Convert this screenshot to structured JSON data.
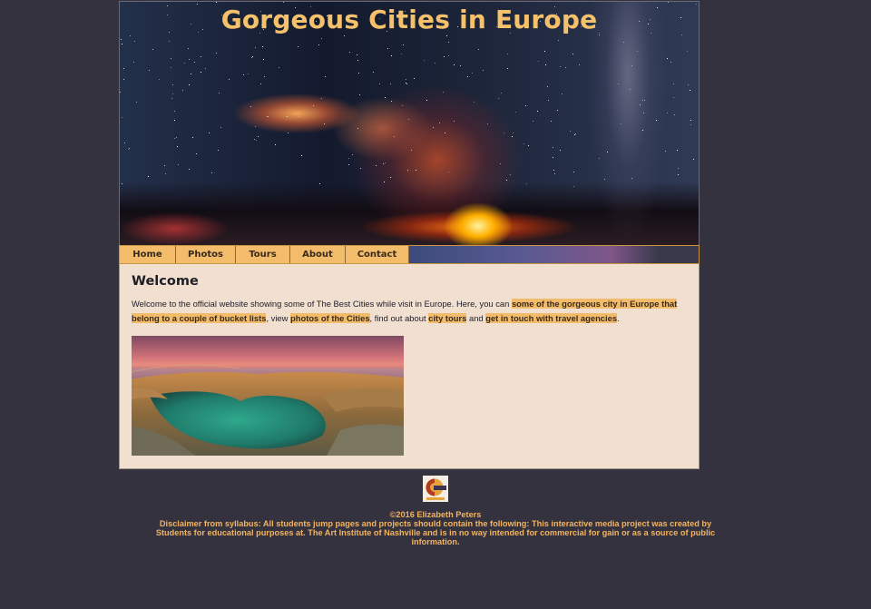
{
  "header": {
    "title": "Gorgeous Cities in Europe"
  },
  "nav": {
    "items": [
      {
        "label": "Home"
      },
      {
        "label": "Photos"
      },
      {
        "label": "Tours"
      },
      {
        "label": "About"
      },
      {
        "label": "Contact"
      }
    ]
  },
  "main": {
    "heading": "Welcome",
    "intro_text_1": "Welcome to the official website showing some of The Best Cities while visit in Europe. Here, you can ",
    "link_gorgeous": "some of the gorgeous city in Europe that belong to a couple of bucket lists",
    "intro_text_2": ", view ",
    "link_photos": "photos of the Cities",
    "intro_text_3": ", find out about ",
    "link_tours": "city tours",
    "intro_text_4": " and ",
    "link_agencies": "get in touch with travel agencies",
    "intro_text_5": "."
  },
  "footer": {
    "copyright": "©2016 Elizabeth Peters",
    "disclaimer": "Disclaimer from syllabus: All students jump pages and projects should contain the following: This interactive media project was created by Students for educational purposes at. The Art Institute of Nashville and is in no way intended for commercial for gain or as a source of public information."
  },
  "colors": {
    "page_background": "#34323f",
    "title": "#f5c26b",
    "nav_tab": "#f2bc6b",
    "content_background": "#f1dfcf",
    "link_highlight": "#f2bc6b",
    "footer_text": "#f3b460"
  },
  "icons": {
    "footer_logo": "art-institute-logo-icon"
  }
}
